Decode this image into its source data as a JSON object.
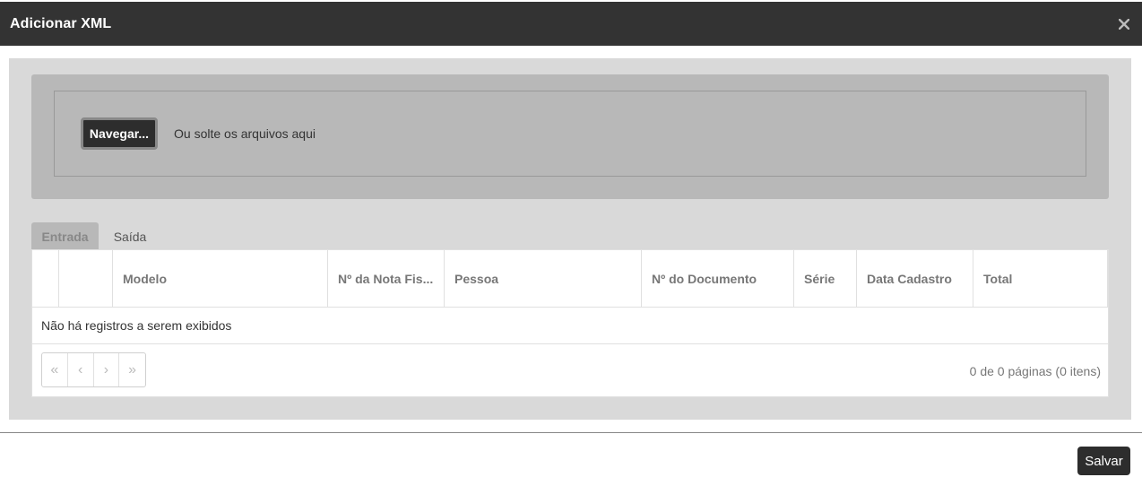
{
  "modal": {
    "title": "Adicionar XML",
    "close_icon": "close-icon"
  },
  "upload": {
    "browse_label": "Navegar...",
    "drop_hint": "Ou solte os arquivos aqui"
  },
  "tabs": [
    {
      "label": "Entrada",
      "active": true
    },
    {
      "label": "Saída",
      "active": false
    }
  ],
  "grid": {
    "columns": [
      "",
      "",
      "Modelo",
      "Nº da Nota Fis...",
      "Pessoa",
      "Nº do Documento",
      "Série",
      "Data Cadastro",
      "Total"
    ],
    "empty_message": "Não há registros a serem exibidos",
    "pager": {
      "first": "«",
      "prev": "‹",
      "next": "›",
      "last": "»",
      "info": "0 de 0 páginas (0 itens)"
    }
  },
  "footer": {
    "save_label": "Salvar"
  },
  "colors": {
    "header_bg": "#333333",
    "panel_bg": "#d9d9d9",
    "drop_bg": "#b8b8b8",
    "button_bg": "#2d2d2d"
  }
}
